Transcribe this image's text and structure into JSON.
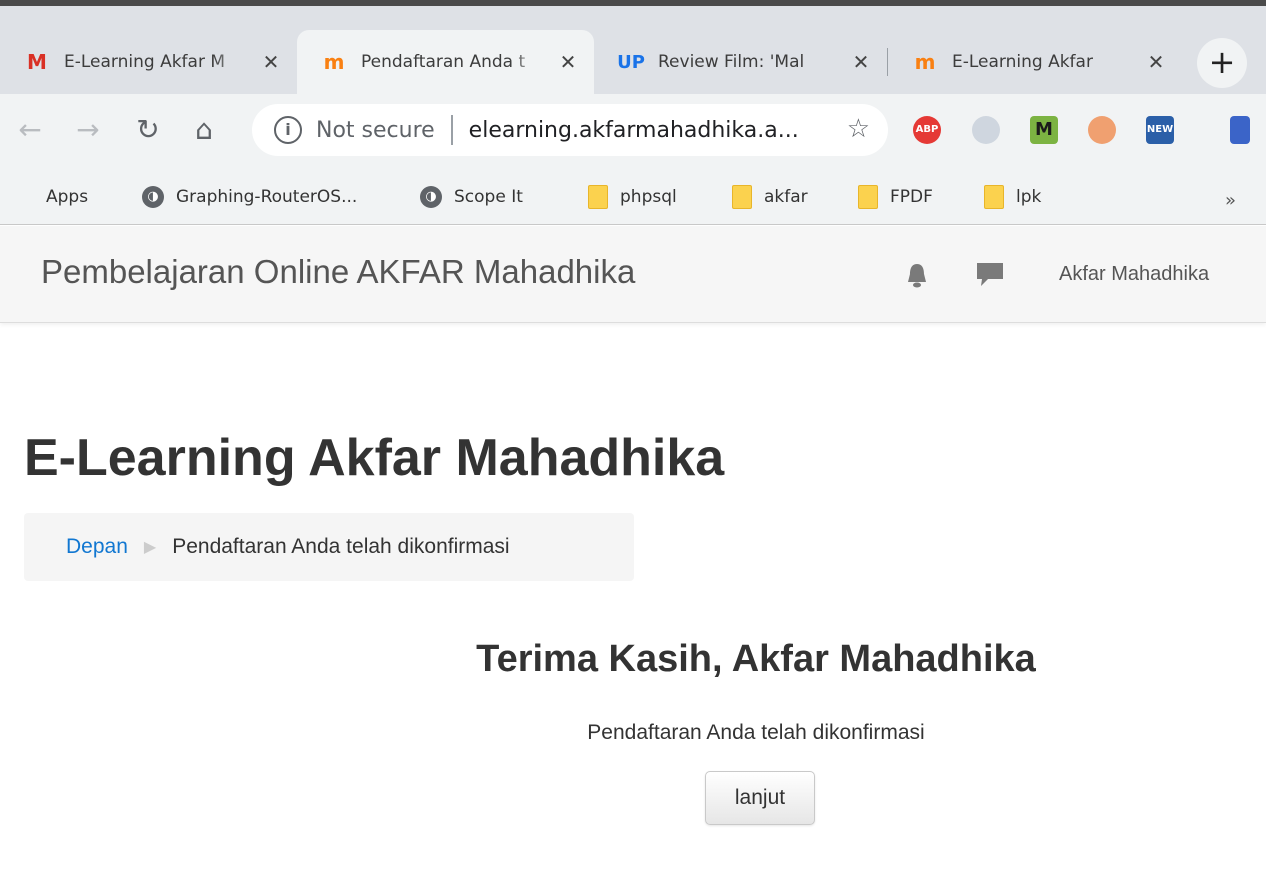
{
  "browser": {
    "tabs": [
      {
        "title": "E-Learning Akfar M",
        "favicon": "gmail-icon",
        "active": false
      },
      {
        "title": "Pendaftaran Anda t",
        "favicon": "moodle-icon",
        "active": true
      },
      {
        "title": "Review Film: 'Mal",
        "favicon": "uplift-icon",
        "active": false
      },
      {
        "title": "E-Learning Akfar",
        "favicon": "moodle-icon",
        "active": false
      }
    ],
    "close_glyph": "✕",
    "new_tab_glyph": "+",
    "omnibox": {
      "security_label": "Not secure",
      "url": "elearning.akfarmahadhika.a..."
    },
    "extensions": [
      "ABP",
      "M",
      "NEW"
    ],
    "bookmarks": [
      {
        "label": "Apps",
        "icon": "apps-grid-icon"
      },
      {
        "label": "Graphing-RouterOS...",
        "icon": "globe-icon"
      },
      {
        "label": "Scope It",
        "icon": "globe-icon"
      },
      {
        "label": "phpsql",
        "icon": "folder-icon"
      },
      {
        "label": "akfar",
        "icon": "folder-icon"
      },
      {
        "label": "FPDF",
        "icon": "folder-icon"
      },
      {
        "label": "lpk",
        "icon": "folder-icon"
      }
    ],
    "overflow_glyph": "»"
  },
  "navbar": {
    "brand": "Pembelajaran Online AKFAR Mahadhika",
    "user_name": "Akfar Mahadhika"
  },
  "page": {
    "heading": "E-Learning Akfar Mahadhika",
    "breadcrumb": {
      "home": "Depan",
      "current": "Pendaftaran Anda telah dikonfirmasi"
    },
    "thanks_heading": "Terima Kasih, Akfar Mahadhika",
    "message": "Pendaftaran Anda telah dikonfirmasi",
    "continue_button": "lanjut"
  },
  "colors": {
    "link": "#1177d1",
    "text": "#333333",
    "navbar_bg": "#f6f6f6"
  }
}
